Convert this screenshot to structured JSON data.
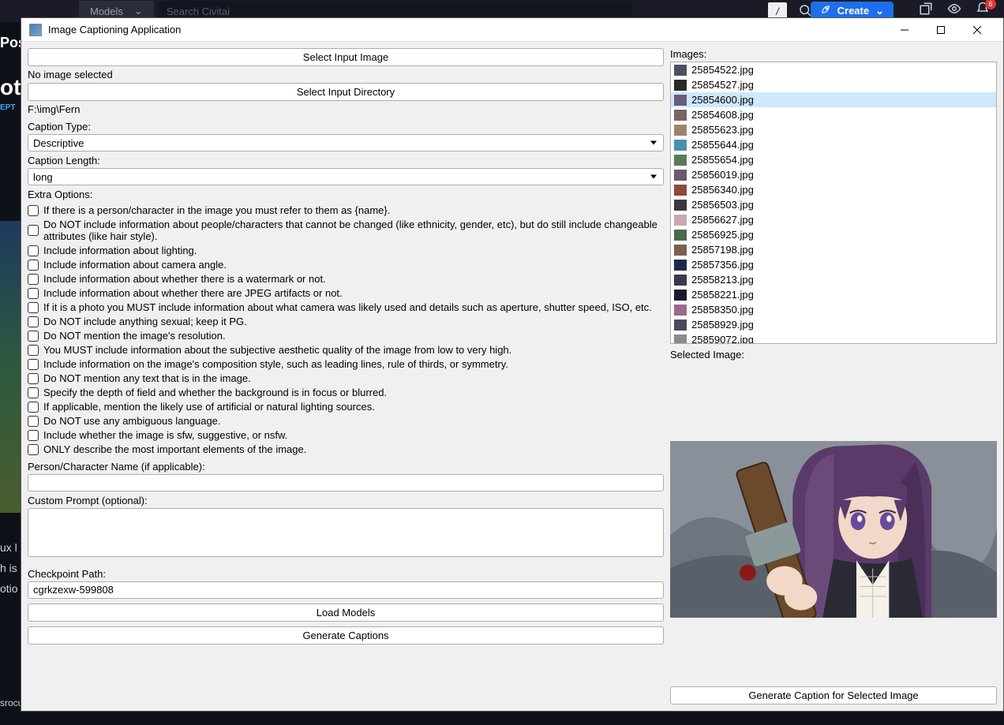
{
  "background": {
    "models_label": "Models",
    "search_placeholder": "Search Civitai",
    "create_label": "Create",
    "badge_count": "6",
    "left_fragments": [
      "Pos",
      "ot",
      "EPT"
    ],
    "bottom_fragments": [
      "ux l",
      "h is",
      "otio",
      "srocu"
    ]
  },
  "window": {
    "title": "Image Captioning Application",
    "select_input_image": "Select Input Image",
    "no_image_selected": "No image selected",
    "select_input_directory": "Select Input Directory",
    "directory_path": "F:\\img\\Fern",
    "caption_type_label": "Caption Type:",
    "caption_type_value": "Descriptive",
    "caption_length_label": "Caption Length:",
    "caption_length_value": "long",
    "extra_options_label": "Extra Options:",
    "extra_options": [
      "If there is a person/character in the image you must refer to them as {name}.",
      "Do NOT include information about people/characters that cannot be changed (like ethnicity, gender, etc), but do still include changeable attributes (like hair style).",
      "Include information about lighting.",
      "Include information about camera angle.",
      "Include information about whether there is a watermark or not.",
      "Include information about whether there are JPEG artifacts or not.",
      "If it is a photo you MUST include information about what camera was likely used and details such as aperture, shutter speed, ISO, etc.",
      "Do NOT include anything sexual; keep it PG.",
      "Do NOT mention the image's resolution.",
      "You MUST include information about the subjective aesthetic quality of the image from low to very high.",
      "Include information on the image's composition style, such as leading lines, rule of thirds, or symmetry.",
      "Do NOT mention any text that is in the image.",
      "Specify the depth of field and whether the background is in focus or blurred.",
      "If applicable, mention the likely use of artificial or natural lighting sources.",
      "Do NOT use any ambiguous language.",
      "Include whether the image is sfw, suggestive, or nsfw.",
      "ONLY describe the most important elements of the image."
    ],
    "person_name_label": "Person/Character Name (if applicable):",
    "person_name_value": "",
    "custom_prompt_label": "Custom Prompt (optional):",
    "custom_prompt_value": "",
    "checkpoint_label": "Checkpoint Path:",
    "checkpoint_value": "cgrkzexw-599808",
    "load_models_btn": "Load Models",
    "generate_captions_btn": "Generate Captions",
    "images_label": "Images:",
    "images": [
      {
        "name": "25854522.jpg",
        "thumb": "#4a5060"
      },
      {
        "name": "25854527.jpg",
        "thumb": "#2a2a2a"
      },
      {
        "name": "25854600.jpg",
        "thumb": "#6b5b7a",
        "selected": true
      },
      {
        "name": "25854608.jpg",
        "thumb": "#7a6560"
      },
      {
        "name": "25855623.jpg",
        "thumb": "#9a8570"
      },
      {
        "name": "25855644.jpg",
        "thumb": "#4a8fb0"
      },
      {
        "name": "25855654.jpg",
        "thumb": "#5a7a5a"
      },
      {
        "name": "25856019.jpg",
        "thumb": "#6a5a6a"
      },
      {
        "name": "25856340.jpg",
        "thumb": "#8a4a3a"
      },
      {
        "name": "25856503.jpg",
        "thumb": "#3a3a3a"
      },
      {
        "name": "25856627.jpg",
        "thumb": "#caa8b0"
      },
      {
        "name": "25856925.jpg",
        "thumb": "#4a6a4a"
      },
      {
        "name": "25857198.jpg",
        "thumb": "#7a6050"
      },
      {
        "name": "25857356.jpg",
        "thumb": "#1a2a4a"
      },
      {
        "name": "25858213.jpg",
        "thumb": "#3a3a4a"
      },
      {
        "name": "25858221.jpg",
        "thumb": "#1a1a2a"
      },
      {
        "name": "25858350.jpg",
        "thumb": "#9a6a8a"
      },
      {
        "name": "25858929.jpg",
        "thumb": "#4a4a5a"
      },
      {
        "name": "25859072.jpg",
        "thumb": "#8a8a8a"
      }
    ],
    "selected_image_label": "Selected Image:",
    "generate_single_btn": "Generate Caption for Selected Image"
  }
}
